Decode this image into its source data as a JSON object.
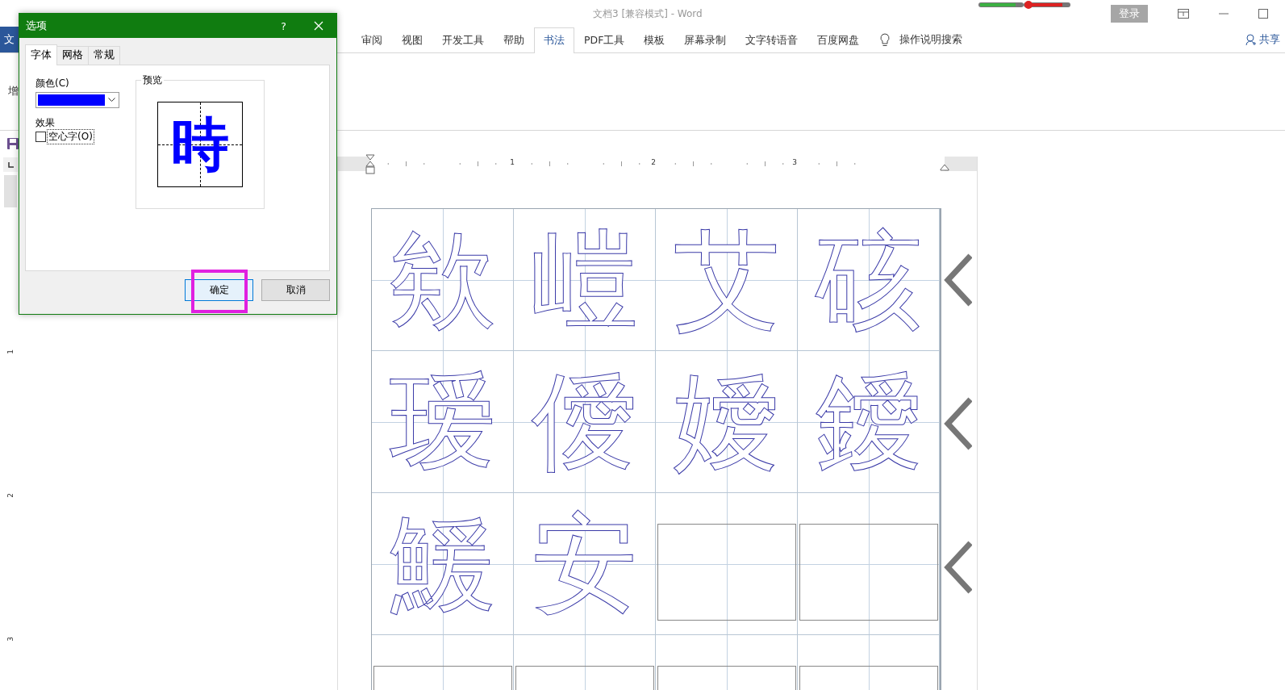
{
  "window": {
    "title": "文档3 [兼容模式]  -  Word",
    "login_button": "登录"
  },
  "ribbon": {
    "file_tab": "文",
    "tabs": [
      {
        "label": "审阅",
        "selected": false
      },
      {
        "label": "视图",
        "selected": false
      },
      {
        "label": "开发工具",
        "selected": false
      },
      {
        "label": "帮助",
        "selected": false
      },
      {
        "label": "书法",
        "selected": true
      },
      {
        "label": "PDF工具",
        "selected": false
      },
      {
        "label": "模板",
        "selected": false
      },
      {
        "label": "屏幕录制",
        "selected": false
      },
      {
        "label": "文字转语音",
        "selected": false
      },
      {
        "label": "百度网盘",
        "selected": false
      }
    ],
    "search": "操作说明搜索",
    "share": "共享",
    "group_label": "增"
  },
  "ruler": {
    "numbers": [
      "1",
      "2",
      "3"
    ]
  },
  "vertical_ruler": {
    "numbers": [
      "1",
      "2",
      "3"
    ]
  },
  "grid": {
    "rows": [
      [
        {
          "kind": "char",
          "text": "欸"
        },
        {
          "kind": "char",
          "text": "嵦"
        },
        {
          "kind": "char",
          "text": "艾"
        },
        {
          "kind": "char",
          "text": "硋"
        }
      ],
      [
        {
          "kind": "char",
          "text": "瑷"
        },
        {
          "kind": "char",
          "text": "僾"
        },
        {
          "kind": "char",
          "text": "嬡"
        },
        {
          "kind": "char",
          "text": "鑀"
        }
      ],
      [
        {
          "kind": "char",
          "text": "鰀"
        },
        {
          "kind": "char",
          "text": "安"
        },
        {
          "kind": "empty"
        },
        {
          "kind": "empty"
        }
      ],
      [
        {
          "kind": "empty"
        },
        {
          "kind": "empty"
        },
        {
          "kind": "empty"
        },
        {
          "kind": "empty"
        }
      ]
    ]
  },
  "dialog": {
    "title": "选项",
    "help": "?",
    "tabs": [
      {
        "label": "字体",
        "selected": true
      },
      {
        "label": "网格",
        "selected": false
      },
      {
        "label": "常规",
        "selected": false
      }
    ],
    "color_label": "颜色(C)",
    "color": "#0000ff",
    "effects_label": "效果",
    "hollow": {
      "label": "空心字(O)",
      "checked": false
    },
    "preview_label": "预览",
    "preview_char": "時",
    "ok_button": "确定",
    "cancel_button": "取消",
    "ok_highlighted": true
  }
}
